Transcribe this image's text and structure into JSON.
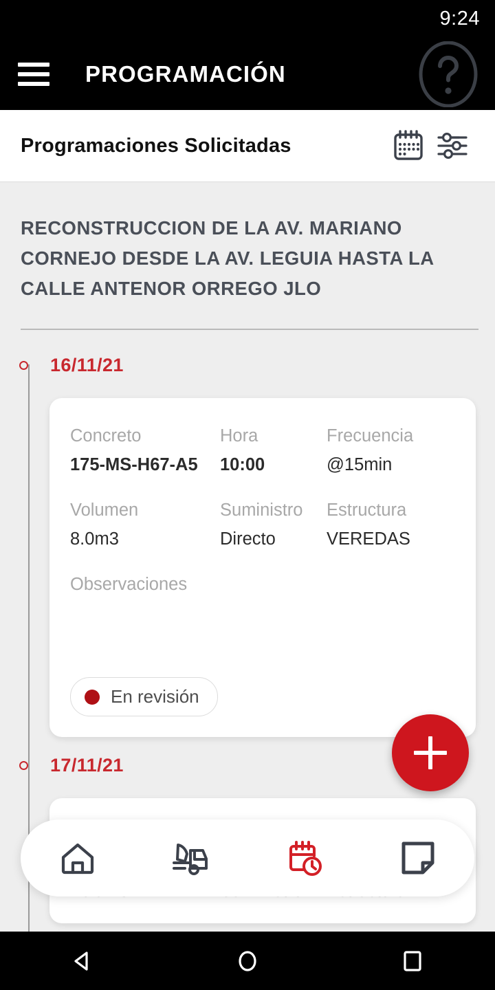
{
  "status_bar": {
    "clock": "9:24"
  },
  "app_bar": {
    "menu_icon": "hamburger-menu-icon",
    "title": "PROGRAMACIÓN",
    "help_icon": "help-circle-icon"
  },
  "sub_header": {
    "title": "Programaciones Solicitadas",
    "calendar_icon": "calendar-icon",
    "filter_icon": "filter-sliders-icon"
  },
  "project": {
    "title": "RECONSTRUCCION DE LA AV. MARIANO CORNEJO DESDE LA AV. LEGUIA HASTA LA CALLE ANTENOR ORREGO JLO"
  },
  "timeline": {
    "entries": [
      {
        "date": "16/11/21",
        "card": {
          "fields": [
            {
              "label": "Concreto",
              "value": "175-MS-H67-A5"
            },
            {
              "label": "Hora",
              "value": "10:00"
            },
            {
              "label": "Frecuencia",
              "value": "@15min"
            },
            {
              "label": "Volumen",
              "value": "8.0m3"
            },
            {
              "label": "Suministro",
              "value": "Directo"
            },
            {
              "label": "Estructura",
              "value": "VEREDAS"
            }
          ],
          "observations_label": "Observaciones",
          "observations_value": "",
          "status": {
            "label": "En revisión",
            "color": "#af1015"
          }
        }
      },
      {
        "date": "17/11/21",
        "card": {
          "fields": [
            {
              "label": "Volumen",
              "value": ""
            },
            {
              "label": "Suministro",
              "value": ""
            },
            {
              "label": "Estructura",
              "value": ""
            }
          ]
        }
      }
    ]
  },
  "fab": {
    "label": "+",
    "icon": "plus-icon",
    "color": "#ce161e"
  },
  "bottom_nav": {
    "items": [
      {
        "name": "home",
        "icon": "home-icon",
        "active": false
      },
      {
        "name": "despacho",
        "icon": "mixer-truck-icon",
        "active": false
      },
      {
        "name": "programacion",
        "icon": "calendar-clock-icon",
        "active": true
      },
      {
        "name": "documentos",
        "icon": "document-icon",
        "active": false
      }
    ],
    "active_color": "#d32027",
    "inactive_color": "#3c414b"
  },
  "android_nav": {
    "back_icon": "back-triangle-icon",
    "home_icon": "home-circle-icon",
    "recents_icon": "recents-square-icon"
  }
}
